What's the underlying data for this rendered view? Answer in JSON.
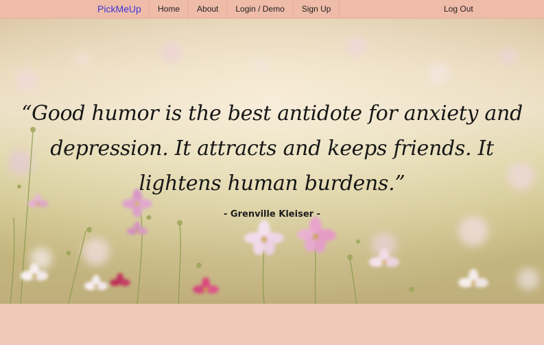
{
  "navbar": {
    "brand": "PickMeUp",
    "links": [
      "Home",
      "About",
      "Login / Demo",
      "Sign Up"
    ],
    "logout": "Log Out"
  },
  "hero": {
    "quote_lines": [
      "“Good humor is the best antidote for anxiety and",
      "depression. It attracts and keeps friends. It",
      "lightens human burdens.”"
    ],
    "author": "- Grenville Kleiser -"
  },
  "colors": {
    "navbar_bg": "#efbca9",
    "brand": "#3e36d6",
    "page_bg": "#f0c8b8"
  }
}
